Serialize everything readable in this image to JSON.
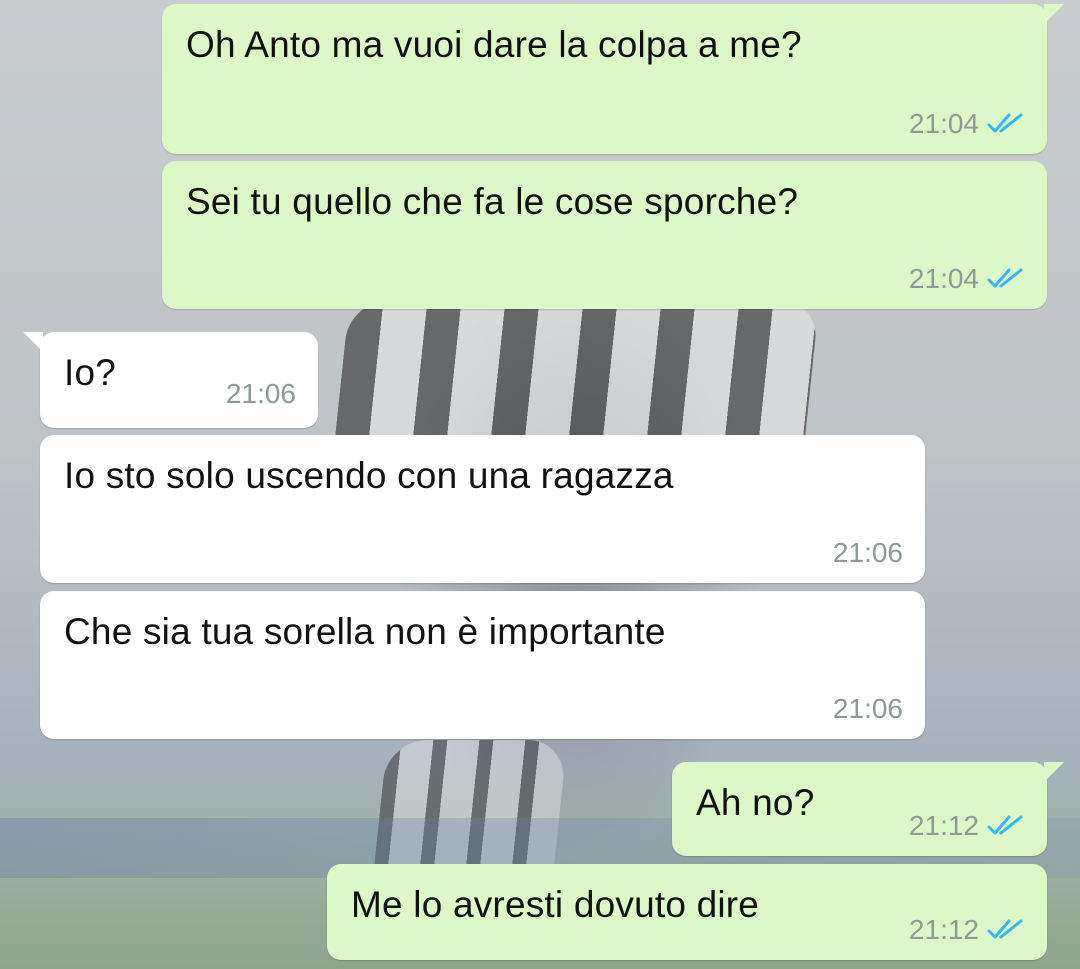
{
  "chat": {
    "messages": [
      {
        "text": "Oh Anto ma vuoi dare la colpa a me?",
        "time": "21:04",
        "direction": "outgoing",
        "status_icon": "double-check-read-icon"
      },
      {
        "text": "Sei tu quello che fa le cose sporche?",
        "time": "21:04",
        "direction": "outgoing",
        "status_icon": "double-check-read-icon"
      },
      {
        "text": "Io?",
        "time": "21:06",
        "direction": "incoming"
      },
      {
        "text": "Io sto solo uscendo con una ragazza",
        "time": "21:06",
        "direction": "incoming"
      },
      {
        "text": "Che sia tua sorella non è importante",
        "time": "21:06",
        "direction": "incoming"
      },
      {
        "text": "Ah no?",
        "time": "21:12",
        "direction": "outgoing",
        "status_icon": "double-check-read-icon"
      },
      {
        "text": "Me lo avresti dovuto dire",
        "time": "21:12",
        "direction": "outgoing",
        "status_icon": "double-check-read-icon"
      }
    ]
  },
  "colors": {
    "outgoing_bubble": "#dcf8c6",
    "incoming_bubble": "#ffffff",
    "time_text": "#8d9a96",
    "read_ticks": "#34b7f1"
  }
}
